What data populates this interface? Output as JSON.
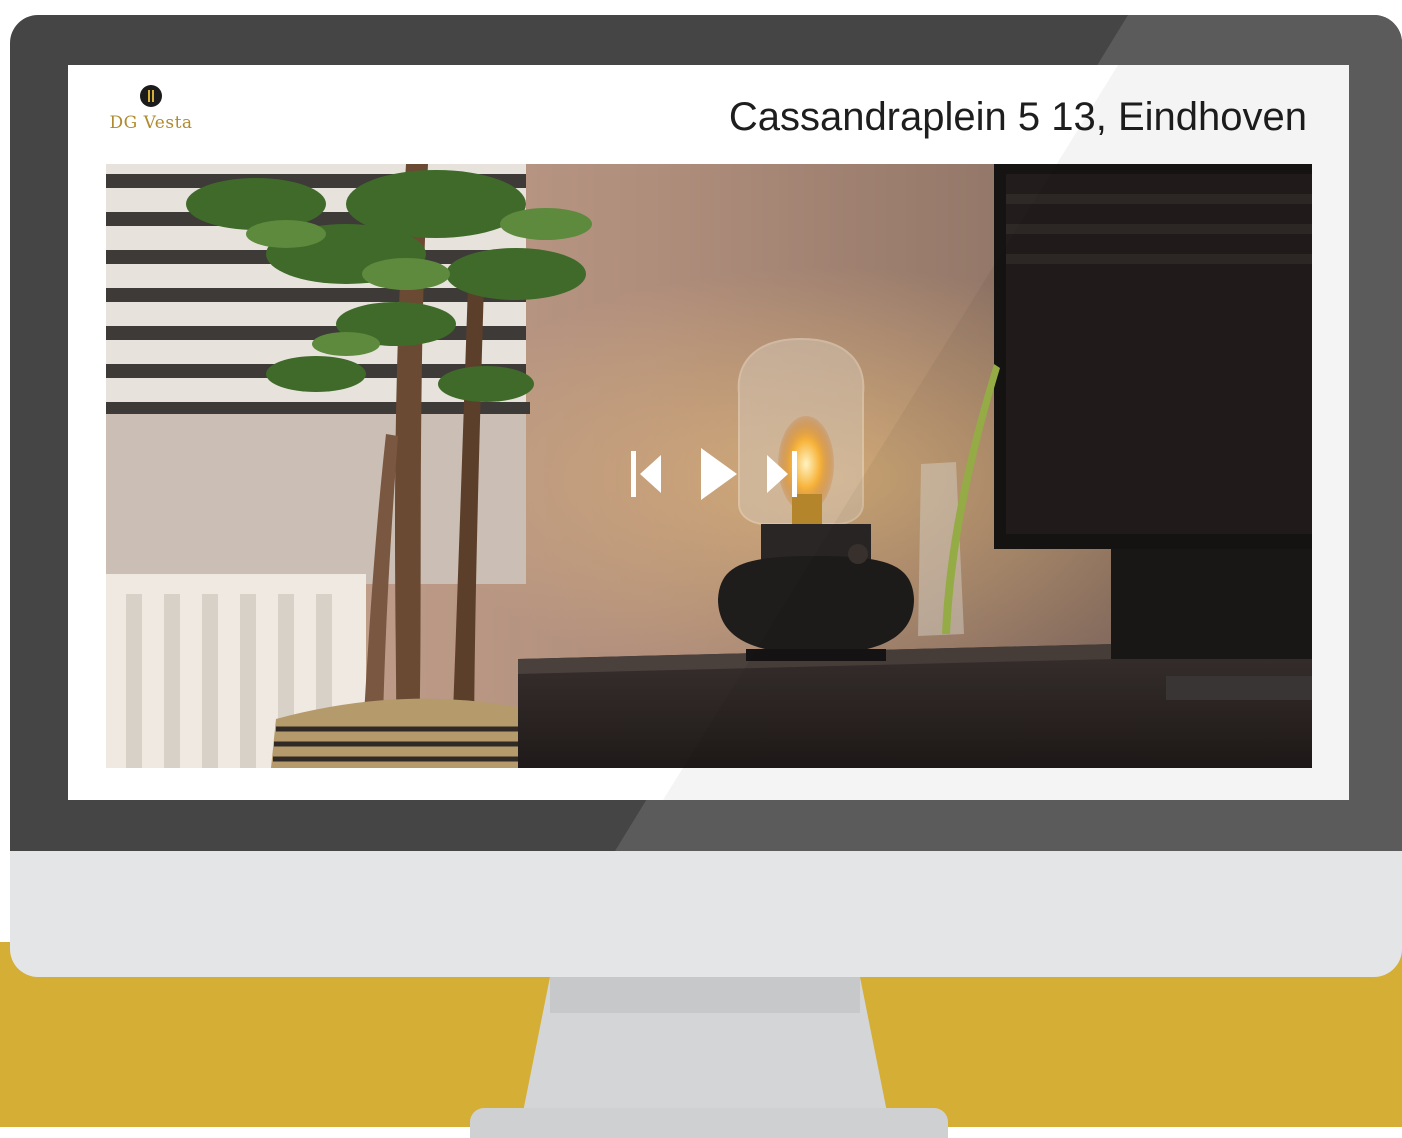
{
  "brand": {
    "name": "DG Vesta",
    "logo_icon": "dg-vesta-logo-icon"
  },
  "listing": {
    "address": "Cassandraplein 5 13, Eindhoven"
  },
  "slideshow": {
    "photo_icon": "interior-photo-lamp-plant",
    "controls": {
      "previous_icon": "skip-previous-icon",
      "play_icon": "play-icon",
      "next_icon": "skip-next-icon"
    }
  },
  "colors": {
    "accent_gold": "#d4ae35",
    "bezel": "#454545",
    "chin": "#e4e5e7",
    "screen": "#ffffff"
  }
}
